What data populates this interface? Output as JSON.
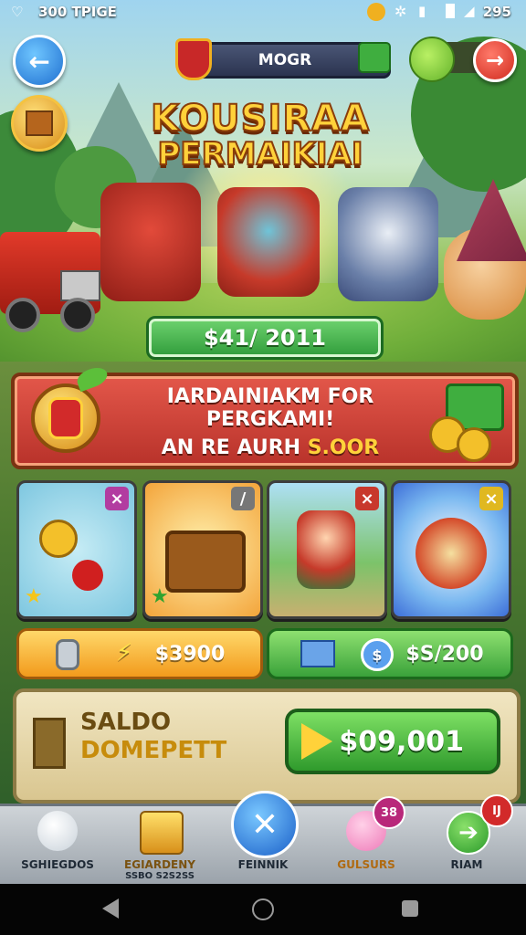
{
  "status_bar": {
    "left_text": "300 TPIGE",
    "right_text": "295"
  },
  "header": {
    "title": "MOGR"
  },
  "game_title": {
    "line1": "KOUSIRAA",
    "line2": "PERMAIKIAI"
  },
  "hero_price": "$41/ 2011",
  "promo": {
    "line1": "IARDAINIAKM FOR PERGKAMI!",
    "line2_prefix": "AN RE AURH ",
    "line2_highlight": "S.OOR"
  },
  "cards": [
    {
      "name": "coins-cherries",
      "badge_color": "#b23ca0"
    },
    {
      "name": "treasure-chest",
      "badge_color": "#777777"
    },
    {
      "name": "robot-warrior",
      "badge_color": "#c8382c"
    },
    {
      "name": "mystery-orb",
      "badge_color": "#e0b820"
    }
  ],
  "buy_buttons": {
    "left": {
      "label": "$3900"
    },
    "right": {
      "label": "$S/200"
    }
  },
  "saldo": {
    "label_line1": "SALDO",
    "label_line2": "DOMEPETT",
    "amount": "$09,001"
  },
  "nav": [
    {
      "label": "SGHIEGDOS",
      "icon": "ghost-icon"
    },
    {
      "label": "EGIARDENY",
      "sub": "SSBO  S2S2SS",
      "icon": "gold-bars-icon"
    },
    {
      "label": "FEINNIK",
      "icon": "close-icon"
    },
    {
      "label": "GULSURS",
      "badge": "38",
      "icon": "pig-icon"
    },
    {
      "label": "RIAM",
      "badge": "IJ",
      "icon": "arrow-icon"
    }
  ],
  "colors": {
    "accent_green": "#2f9b3a",
    "promo_red": "#c83a2c",
    "gold": "#ffd23a"
  }
}
